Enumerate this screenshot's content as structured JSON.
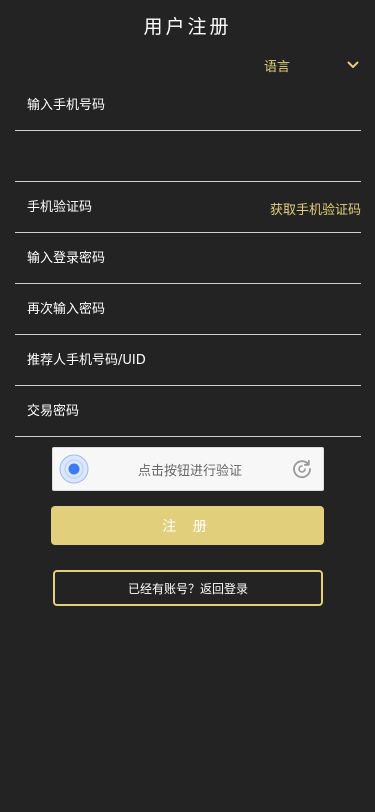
{
  "header": {
    "title": "用户注册"
  },
  "language": {
    "label": "语言"
  },
  "form": {
    "fields": [
      {
        "placeholder": "输入手机号码",
        "value": ""
      },
      {
        "placeholder": "",
        "value": ""
      },
      {
        "placeholder": "手机验证码",
        "value": "",
        "action_label": "获取手机验证码"
      },
      {
        "placeholder": "输入登录密码",
        "value": ""
      },
      {
        "placeholder": "再次输入密码",
        "value": ""
      },
      {
        "placeholder": "推荐人手机号码/UID",
        "value": ""
      },
      {
        "placeholder": "交易密码",
        "value": ""
      }
    ],
    "captcha": {
      "label": "点击按钮进行验证"
    },
    "register_label": "注 册",
    "login_link_label": "已经有账号？返回登录"
  },
  "colors": {
    "background": "#232323",
    "accent": "#e1cf7c",
    "divider": "#cfcfcf",
    "captcha_blue": "#3c7cf0"
  },
  "icons": {
    "language_chevron": "chevron-down-icon",
    "captcha_radar": "radar-icon",
    "captcha_refresh": "refresh-icon"
  }
}
